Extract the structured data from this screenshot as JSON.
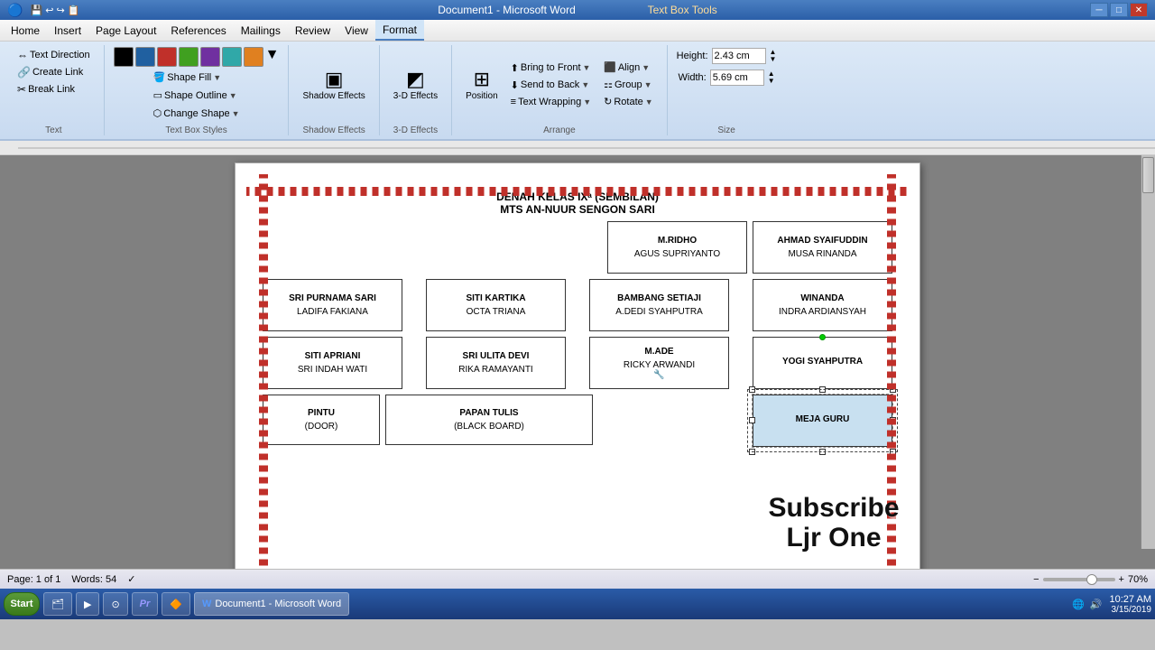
{
  "titlebar": {
    "doc_title": "Document1 - Microsoft Word",
    "tool_title": "Text Box Tools",
    "min_btn": "─",
    "max_btn": "□",
    "close_btn": "✕"
  },
  "menubar": {
    "items": [
      "Home",
      "Insert",
      "Page Layout",
      "References",
      "Mailings",
      "Review",
      "View",
      "Format"
    ]
  },
  "ribbon": {
    "active_tab": "Format",
    "text_group": {
      "label": "Text",
      "direction_btn": "Text Direction",
      "create_link_btn": "Create Link",
      "break_link_btn": "Break Link"
    },
    "textbox_styles_group": {
      "label": "Text Box Styles",
      "colors": [
        "#000000",
        "#2060a0",
        "#c0302a",
        "#40a020",
        "#7030a0",
        "#30a8a8",
        "#e08020"
      ],
      "shape_fill_label": "Shape Fill",
      "shape_outline_label": "Shape Outline",
      "change_shape_label": "Change Shape"
    },
    "shadow_group": {
      "label": "Shadow Effects",
      "shadow_btn": "Shadow Effects"
    },
    "effects_3d_group": {
      "label": "3-D Effects",
      "btn": "3-D Effects"
    },
    "arrange_group": {
      "label": "Arrange",
      "bring_front": "Bring to Front",
      "send_back": "Send to Back",
      "text_wrapping": "Text Wrapping",
      "align": "Align",
      "group": "Group",
      "rotate": "Rotate",
      "position": "Position"
    },
    "size_group": {
      "label": "Size",
      "height_label": "Height:",
      "height_value": "2.43 cm",
      "width_label": "Width:",
      "width_value": "5.69 cm"
    }
  },
  "document": {
    "title1": "DENAH KELAS IXᵃ (SEMBILAN)",
    "title2": "MTS AN-NUUR SENGON SARI",
    "seats": [
      {
        "id": "s1",
        "top": "M.RIDHO",
        "bottom": "AGUS SUPRIYANTO",
        "row": 1,
        "col": 2
      },
      {
        "id": "s2",
        "top": "AHMAD SYAIFUDDIN",
        "bottom": "MUSA RINANDA",
        "row": 1,
        "col": 3
      },
      {
        "id": "s3",
        "top": "SRI PURNAMA SARI",
        "bottom": "LADIFA FAKIANA",
        "row": 2,
        "col": 0
      },
      {
        "id": "s4",
        "top": "SITI KARTIKA",
        "bottom": "OCTA TRIANA",
        "row": 2,
        "col": 1
      },
      {
        "id": "s5",
        "top": "BAMBANG SETIAJI",
        "bottom": "A.DEDI SYAHPUTRA",
        "row": 2,
        "col": 2
      },
      {
        "id": "s6",
        "top": "WINANDA",
        "bottom": "INDRA ARDIANSYAH",
        "row": 2,
        "col": 3
      },
      {
        "id": "s7",
        "top": "SITI APRIANI",
        "bottom": "SRI INDAH WATI",
        "row": 3,
        "col": 0
      },
      {
        "id": "s8",
        "top": "SRI ULITA DEVI",
        "bottom": "RIKA RAMAYANTI",
        "row": 3,
        "col": 1
      },
      {
        "id": "s9",
        "top": "M.ADE",
        "bottom": "RICKY ARWANDI",
        "row": 3,
        "col": 2
      },
      {
        "id": "s10",
        "top": "YOGI SYAHPUTRA",
        "bottom": "",
        "row": 3,
        "col": 3
      },
      {
        "id": "s11",
        "top": "PINTU",
        "bottom": "(DOOR)",
        "row": 4,
        "col": 0
      },
      {
        "id": "s12",
        "top": "PAPAN TULIS",
        "bottom": "(BLACK BOARD)",
        "row": 4,
        "col": 1,
        "wide": true
      }
    ],
    "meja_guru": "MEJA GURU"
  },
  "statusbar": {
    "page": "Page: 1 of 1",
    "words": "Words: 54",
    "spell_icon": "✓",
    "zoom": "70%",
    "zoom_value": 70
  },
  "taskbar": {
    "start_label": "Start",
    "apps": [
      {
        "name": "File Explorer",
        "icon": "🗂"
      },
      {
        "name": "WMP",
        "icon": "▶"
      },
      {
        "name": "Chrome",
        "icon": "⊙"
      },
      {
        "name": "Adobe Premiere",
        "icon": "Pr"
      },
      {
        "name": "VLC",
        "icon": "🔶"
      },
      {
        "name": "Word",
        "icon": "W"
      }
    ],
    "active_app": "Word",
    "doc_btn": "Document1 - Microsoft Word",
    "time": "10:27 AM",
    "date": "3/15/2019"
  },
  "subscribe": {
    "line1": "Subscribe",
    "line2": "Ljr One"
  }
}
